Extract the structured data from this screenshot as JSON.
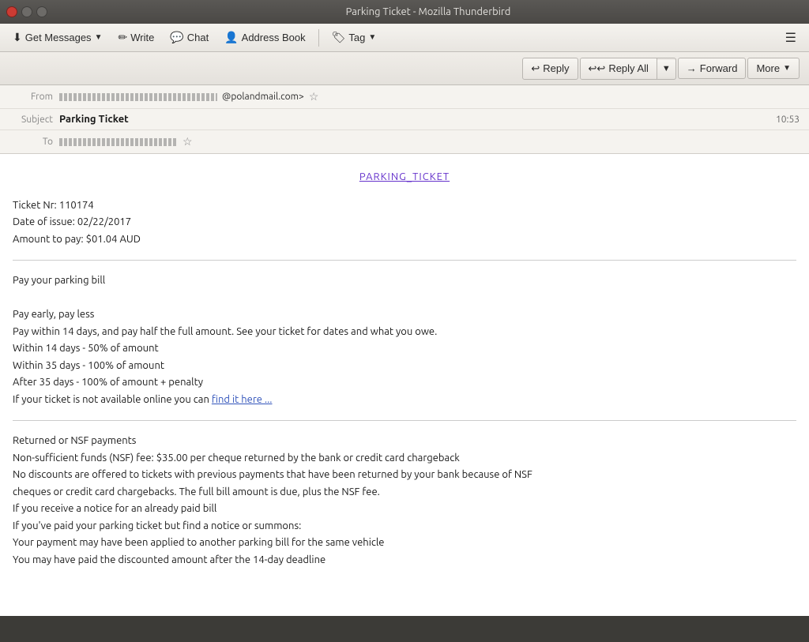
{
  "titleBar": {
    "title": "Parking Ticket - Mozilla Thunderbird"
  },
  "menuBar": {
    "getMessages": "Get Messages",
    "write": "Write",
    "chat": "Chat",
    "addressBook": "Address Book",
    "tag": "Tag"
  },
  "toolbar": {
    "reply": "Reply",
    "replyAll": "Reply All",
    "forward": "Forward",
    "more": "More"
  },
  "emailHeader": {
    "fromLabel": "From",
    "fromDomain": "@polandmail.com>",
    "subjectLabel": "Subject",
    "subject": "Parking Ticket",
    "timestamp": "10:53",
    "toLabel": "To"
  },
  "emailBody": {
    "title": "PARKING_TICKET",
    "ticketNr": "Ticket Nr: 110174",
    "dateOfIssue": "Date of issue: 02/22/2017",
    "amountToPay": "Amount to pay: $01.04 AUD",
    "section1": {
      "heading": "Pay your parking bill",
      "subheading": "Pay early, pay less",
      "line1": "Pay within 14 days, and pay half the full amount. See your ticket for dates and what you owe.",
      "line2": "Within 14 days - 50% of amount",
      "line3": "Within 35 days - 100% of amount",
      "line4": "After 35 days - 100% of amount + penalty",
      "line5pre": "If your ticket is not available online you can ",
      "line5link": "find it here ...",
      "line5end": ""
    },
    "section2": {
      "heading": "Returned or NSF payments",
      "line1": "Non-sufficient funds (NSF) fee: $35.00 per cheque returned by the bank or credit card chargeback",
      "line2": "No discounts are offered to tickets with previous payments that have been returned by your bank because of NSF",
      "line3": "cheques or credit card chargebacks. The full bill amount is due, plus the NSF fee.",
      "line4": "If you receive a notice for an already paid bill",
      "line5": "If you've paid your parking ticket but find a notice or summons:",
      "line6": "Your payment may have been applied to another parking bill for the same vehicle",
      "line7": "You may have paid the discounted amount after the 14-day deadline"
    }
  }
}
